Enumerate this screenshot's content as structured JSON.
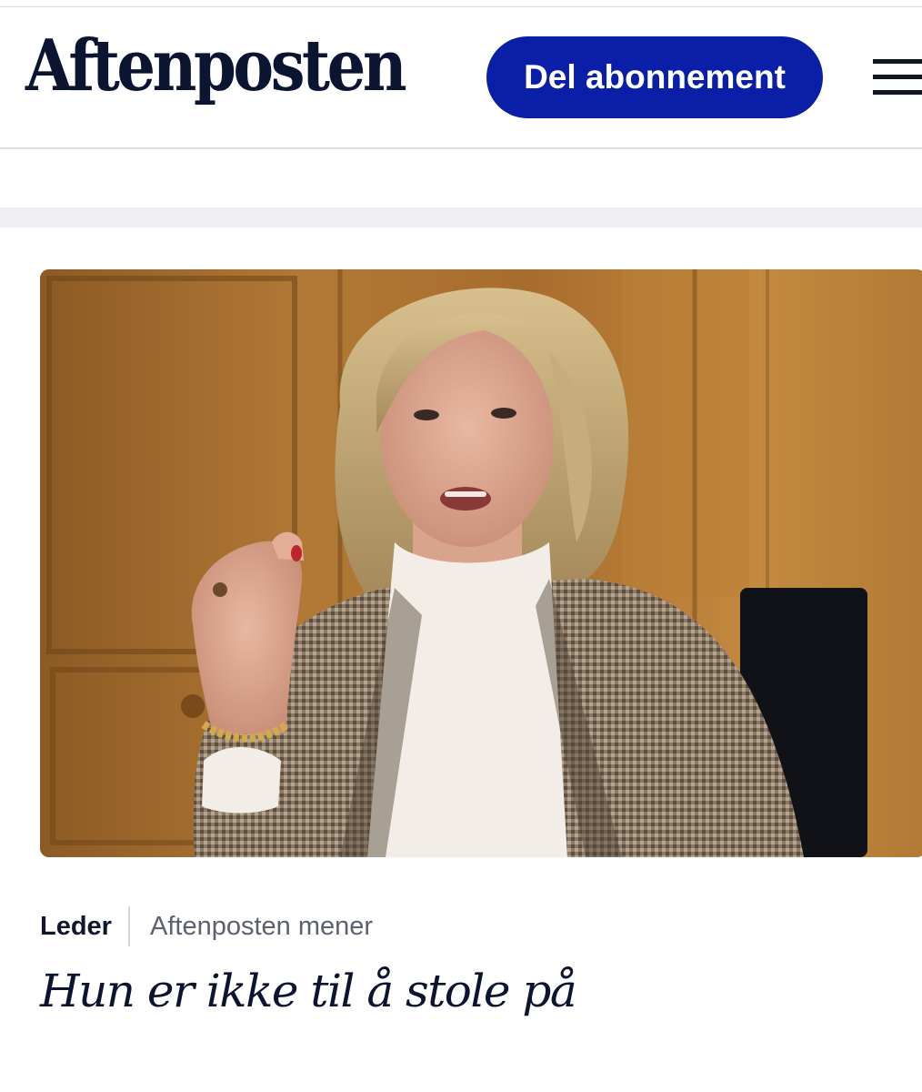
{
  "header": {
    "logo_text": "Aftenposten",
    "subscribe_label": "Del abonnement",
    "menu_icon": "hamburger-menu-icon"
  },
  "article": {
    "image_alt": "Woman in houndstooth blazer and white turtleneck gesturing while speaking in a wood-paneled room",
    "section": "Leder",
    "subsection": "Aftenposten mener",
    "headline": "Hun er ikke til å stole på"
  },
  "colors": {
    "brand_blue": "#0a1ea8",
    "text_dark": "#0c1430",
    "text_gray": "#5c6070"
  }
}
